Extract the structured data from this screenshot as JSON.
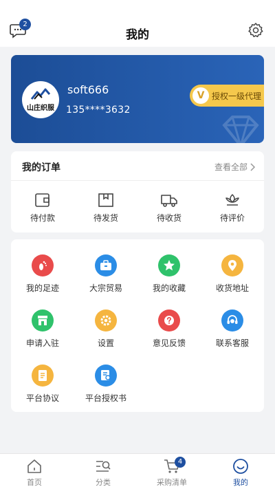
{
  "header": {
    "title": "我的",
    "message_badge": "2"
  },
  "profile": {
    "logo_text": "山庄织服",
    "username": "soft666",
    "phone": "135****3632",
    "auth_badge_icon": "V",
    "auth_badge_text": "授权一级代理"
  },
  "orders": {
    "title": "我的订单",
    "view_all": "查看全部",
    "items": [
      {
        "label": "待付款",
        "icon": "wallet-icon"
      },
      {
        "label": "待发货",
        "icon": "package-icon"
      },
      {
        "label": "待收货",
        "icon": "truck-icon"
      },
      {
        "label": "待评价",
        "icon": "flower-icon"
      }
    ]
  },
  "services": {
    "items": [
      {
        "label": "我的足迹",
        "icon": "footprint-icon",
        "color": "#e94b4b"
      },
      {
        "label": "大宗贸易",
        "icon": "briefcase-icon",
        "color": "#2b8de6"
      },
      {
        "label": "我的收藏",
        "icon": "star-icon",
        "color": "#2fc26b"
      },
      {
        "label": "收货地址",
        "icon": "location-icon",
        "color": "#f5b53f"
      },
      {
        "label": "申请入驻",
        "icon": "store-icon",
        "color": "#2fc26b"
      },
      {
        "label": "设置",
        "icon": "gear-icon",
        "color": "#f5b53f"
      },
      {
        "label": "意见反馈",
        "icon": "question-icon",
        "color": "#e94b4b"
      },
      {
        "label": "联系客服",
        "icon": "headset-icon",
        "color": "#2b8de6"
      },
      {
        "label": "平台协议",
        "icon": "document-icon",
        "color": "#f5b53f"
      },
      {
        "label": "平台授权书",
        "icon": "certificate-icon",
        "color": "#2b8de6"
      }
    ]
  },
  "tabbar": {
    "items": [
      {
        "label": "首页",
        "icon": "home-icon"
      },
      {
        "label": "分类",
        "icon": "category-search-icon"
      },
      {
        "label": "采购清单",
        "icon": "cart-icon",
        "badge": "4"
      },
      {
        "label": "我的",
        "icon": "smile-icon",
        "active": true
      }
    ]
  },
  "colors": {
    "accent": "#1e4fa0",
    "card_gradient_start": "#1c4d96",
    "card_gradient_end": "#2a64b8",
    "badge_gold": "#f5c84c"
  }
}
